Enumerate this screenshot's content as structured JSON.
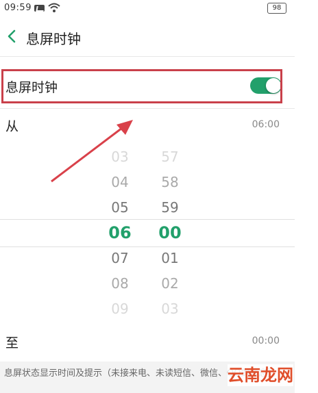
{
  "status_bar": {
    "time": "09:59",
    "battery": "98"
  },
  "header": {
    "title": "息屏时钟"
  },
  "toggle_row": {
    "label": "息屏时钟",
    "enabled": true
  },
  "from_row": {
    "label": "从",
    "value": "06:00"
  },
  "picker": {
    "hours": [
      "03",
      "04",
      "05",
      "06",
      "07",
      "08",
      "09"
    ],
    "minutes": [
      "57",
      "58",
      "59",
      "00",
      "01",
      "02",
      "03"
    ],
    "selected_index": 3
  },
  "to_row": {
    "label": "至",
    "value": "00:00"
  },
  "footer": {
    "description": "息屏状态显示时间及提示（未接来电、未读短信、微信、QQ的消息）。"
  },
  "watermark": "云南龙网",
  "colors": {
    "accent": "#22a06b",
    "highlight_box": "#c9404a",
    "arrow": "#d9414a"
  }
}
